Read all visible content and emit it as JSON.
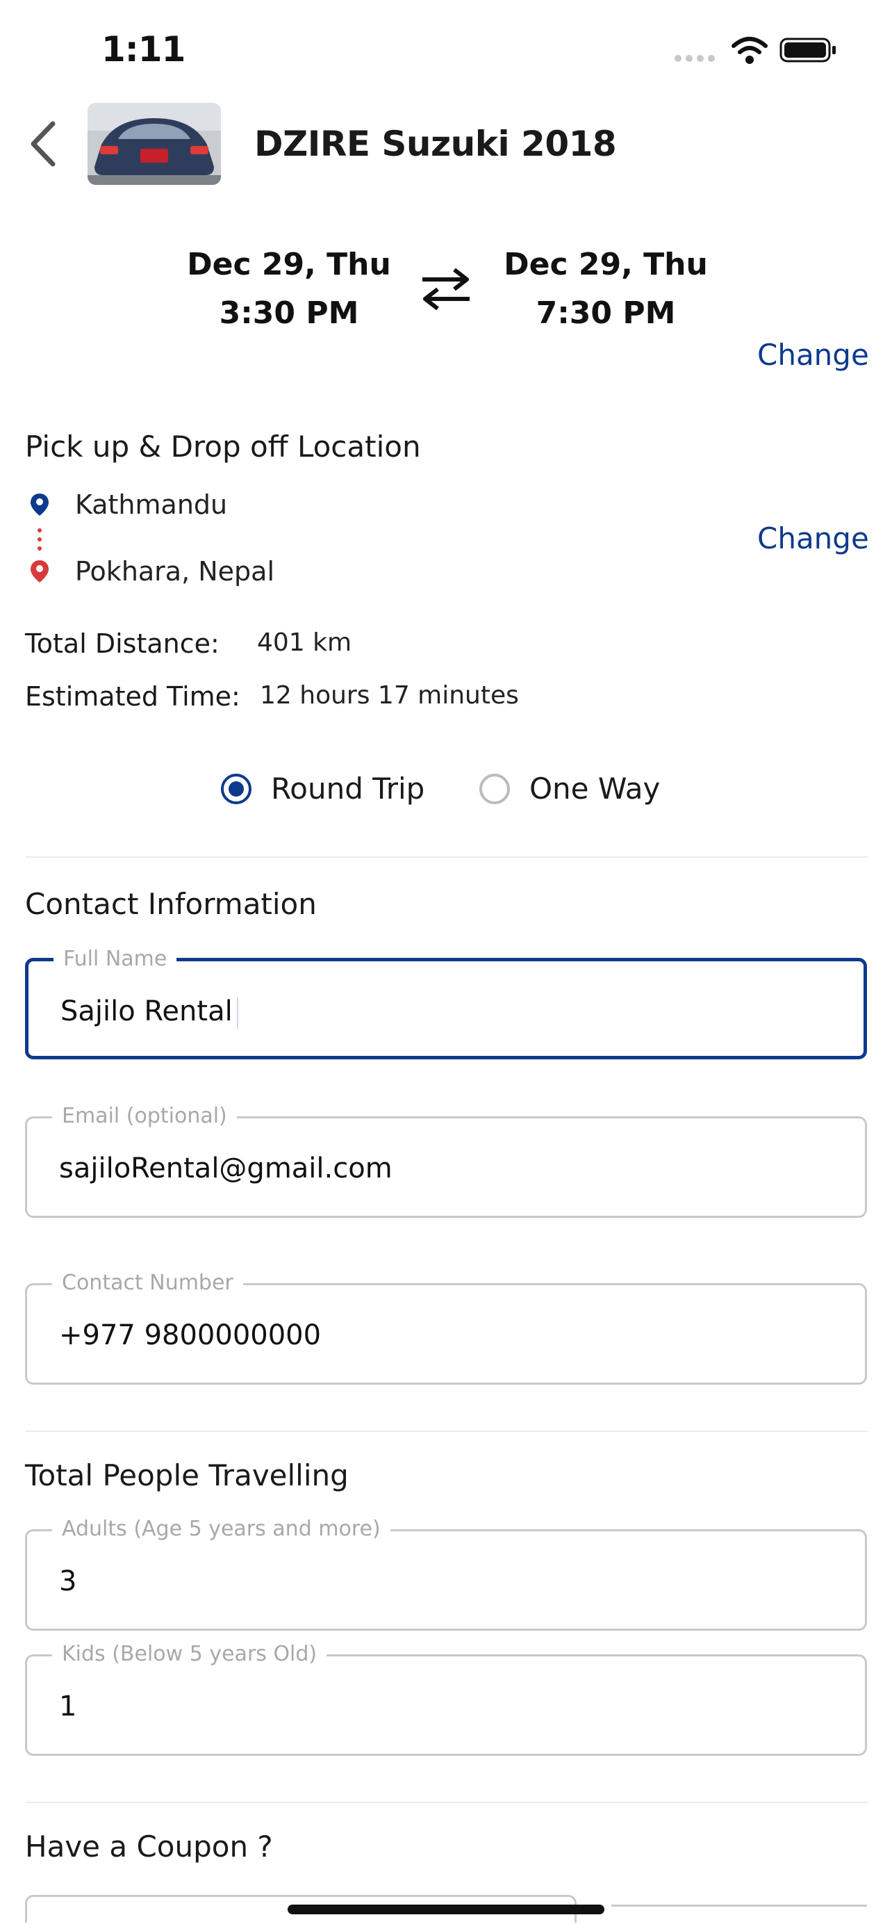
{
  "status_bar": {
    "time": "1:11"
  },
  "header": {
    "title": "DZIRE  Suzuki  2018"
  },
  "schedule": {
    "start_date": "Dec 29, Thu",
    "start_time": "3:30 PM",
    "end_date": "Dec 29, Thu",
    "end_time": "7:30 PM",
    "change_label": "Change"
  },
  "location": {
    "title": "Pick up & Drop off Location",
    "from": "Kathmandu",
    "to": "Pokhara, Nepal",
    "change_label": "Change"
  },
  "trip_info": {
    "distance_label": "Total Distance:",
    "distance_value": "401 km",
    "time_label": "Estimated Time:",
    "time_value": "12 hours 17 minutes"
  },
  "trip_type": {
    "options": [
      "Round Trip",
      "One Way"
    ],
    "selected": "Round Trip"
  },
  "contact": {
    "title": "Contact Information",
    "full_name_label": "Full Name",
    "full_name_value": "Sajilo Rental",
    "email_label": "Email (optional)",
    "email_value": "sajiloRental@gmail.com",
    "phone_label": "Contact Number",
    "phone_value": "+977 9800000000"
  },
  "people": {
    "title": "Total People Travelling",
    "adults_label": "Adults (Age 5 years and more)",
    "adults_value": "3",
    "kids_label": "Kids  (Below 5 years Old)",
    "kids_value": "1"
  },
  "coupon": {
    "title": "Have a Coupon ?"
  },
  "colors": {
    "accent": "#0e3a8c",
    "pin_start": "#0e3a8c",
    "pin_end": "#d83a3a"
  }
}
